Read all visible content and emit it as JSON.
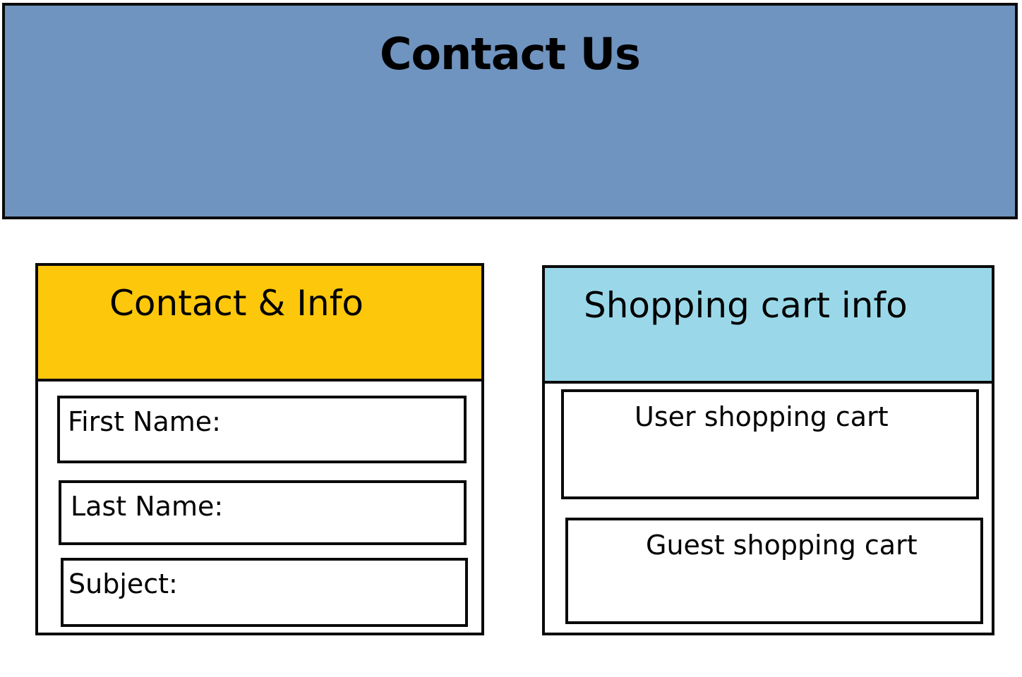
{
  "colors": {
    "header_bg": "#7094c0",
    "contact_head_bg": "#fdc70b",
    "cart_head_bg": "#9ad8e9",
    "border": "#0a0a0a"
  },
  "header": {
    "title": "Contact Us"
  },
  "contact_panel": {
    "title": "Contact & Info",
    "fields": [
      {
        "label": "First Name:"
      },
      {
        "label": "Last Name:"
      },
      {
        "label": "Subject:"
      }
    ]
  },
  "cart_panel": {
    "title": "Shopping cart info",
    "sections": [
      {
        "label": "User shopping cart"
      },
      {
        "label": "Guest shopping cart"
      }
    ]
  }
}
